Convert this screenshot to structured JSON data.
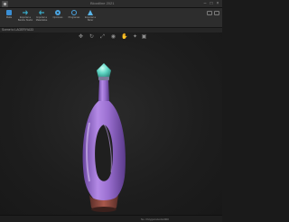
{
  "window": {
    "title": "Bloodline 2021",
    "icon": "app-icon",
    "controls": [
      "minimize-icon",
      "maximize-icon",
      "close-icon"
    ]
  },
  "ribbon": {
    "tools": [
      {
        "label": "Malla",
        "icon": "mesh-icon"
      },
      {
        "label": "Exportar a Bambu Studio",
        "icon": "export-icon"
      },
      {
        "label": "Importar a Materialise",
        "icon": "import-icon"
      },
      {
        "label": "Opciones",
        "icon": "gear-icon"
      },
      {
        "label": "Programas",
        "icon": "magnifier-icon"
      },
      {
        "label": "Exportar a Slicer",
        "icon": "plane-icon"
      }
    ],
    "right_icons": [
      "panel-icon",
      "window-icon"
    ]
  },
  "scene": {
    "label": "Scene to LAGERYIA33"
  },
  "viewport": {
    "toolbar_icons": [
      "move-icon",
      "rotate-icon",
      "scale-icon",
      "view-icon",
      "hand-icon",
      "light-icon",
      "camera-icon"
    ],
    "object": "perfume-bottle-model",
    "colors": {
      "body": "#9a6fd0",
      "stopper": "#5fd6c4",
      "base": "#8a4a40"
    }
  },
  "status": {
    "text": "No. Polygons/units/000"
  }
}
